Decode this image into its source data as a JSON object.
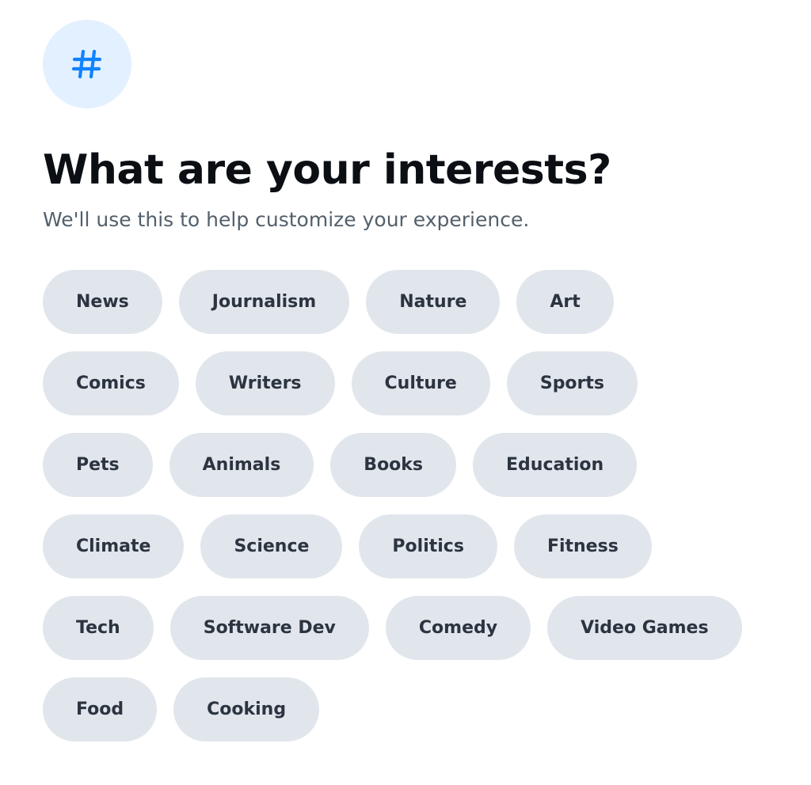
{
  "header": {
    "icon": "hashtag-icon",
    "accent_color": "#1083fe",
    "icon_bg_color": "#e3f0ff",
    "title": "What are your interests?",
    "subtitle": "We'll use this to help customize your experience."
  },
  "interests": [
    {
      "label": "News"
    },
    {
      "label": "Journalism"
    },
    {
      "label": "Nature"
    },
    {
      "label": "Art"
    },
    {
      "label": "Comics"
    },
    {
      "label": "Writers"
    },
    {
      "label": "Culture"
    },
    {
      "label": "Sports"
    },
    {
      "label": "Pets"
    },
    {
      "label": "Animals"
    },
    {
      "label": "Books"
    },
    {
      "label": "Education"
    },
    {
      "label": "Climate"
    },
    {
      "label": "Science"
    },
    {
      "label": "Politics"
    },
    {
      "label": "Fitness"
    },
    {
      "label": "Tech"
    },
    {
      "label": "Software Dev"
    },
    {
      "label": "Comedy"
    },
    {
      "label": "Video Games"
    },
    {
      "label": "Food"
    },
    {
      "label": "Cooking"
    }
  ],
  "chip_style": {
    "background": "#e1e6ec",
    "text_color": "#2b3440"
  }
}
